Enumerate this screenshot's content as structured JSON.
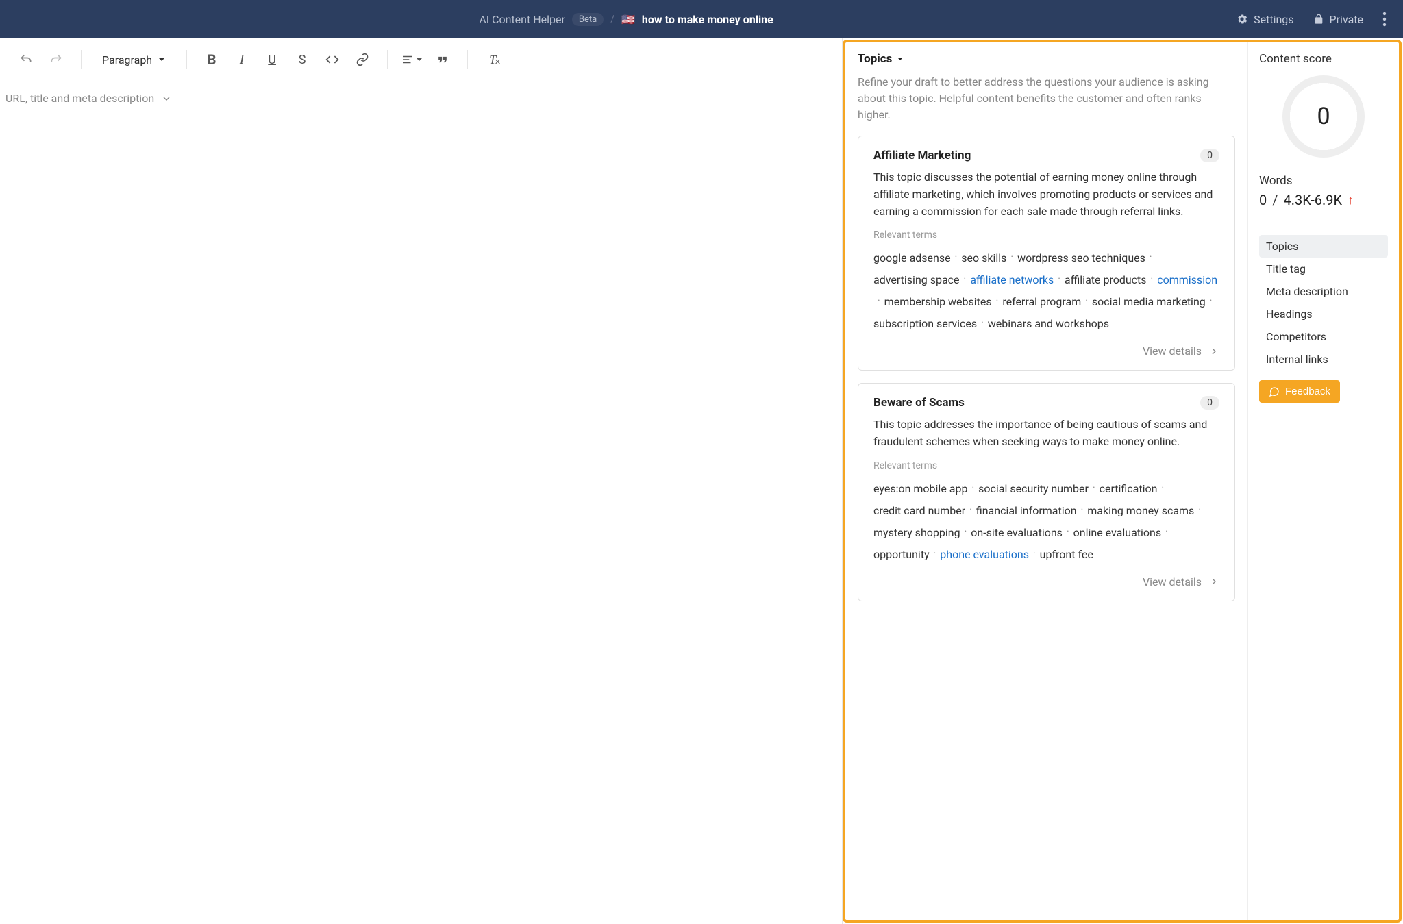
{
  "header": {
    "title": "AI Content Helper",
    "badge": "Beta",
    "separator": "/",
    "flag": "🇺🇸",
    "topic": "how to make money online",
    "settings": "Settings",
    "private": "Private"
  },
  "toolbar": {
    "paragraph": "Paragraph"
  },
  "meta": {
    "label": "URL, title and meta description"
  },
  "topics": {
    "heading": "Topics",
    "description": "Refine your draft to better address the questions your audience is asking about this topic. Helpful content benefits the customer and often ranks higher.",
    "cards": [
      {
        "title": "Affiliate Marketing",
        "count": "0",
        "description": "This topic discusses the potential of earning money online through affiliate marketing, which involves promoting products or services and earning a commission for each sale made through referral links.",
        "terms_label": "Relevant terms",
        "terms": [
          {
            "text": "google adsense"
          },
          {
            "text": "seo skills"
          },
          {
            "text": "wordpress seo techniques"
          },
          {
            "text": "advertising space"
          },
          {
            "text": "affiliate networks",
            "link": true
          },
          {
            "text": "affiliate products"
          },
          {
            "text": "commission",
            "link": true
          },
          {
            "text": "membership websites"
          },
          {
            "text": "referral program"
          },
          {
            "text": "social media marketing"
          },
          {
            "text": "subscription services"
          },
          {
            "text": "webinars and workshops"
          }
        ],
        "view": "View details"
      },
      {
        "title": "Beware of Scams",
        "count": "0",
        "description": "This topic addresses the importance of being cautious of scams and fraudulent schemes when seeking ways to make money online.",
        "terms_label": "Relevant terms",
        "terms": [
          {
            "text": "eyes:on mobile app"
          },
          {
            "text": "social security number"
          },
          {
            "text": "certification"
          },
          {
            "text": "credit card number"
          },
          {
            "text": "financial information"
          },
          {
            "text": "making money scams"
          },
          {
            "text": "mystery shopping"
          },
          {
            "text": "on-site evaluations"
          },
          {
            "text": "online evaluations"
          },
          {
            "text": "opportunity"
          },
          {
            "text": "phone evaluations",
            "link": true
          },
          {
            "text": "upfront fee"
          }
        ],
        "view": "View details"
      }
    ]
  },
  "score": {
    "title": "Content score",
    "value": "0",
    "words_label": "Words",
    "words_count": "0",
    "words_sep": "/",
    "words_range": "4.3K-6.9K",
    "nav": [
      "Topics",
      "Title tag",
      "Meta description",
      "Headings",
      "Competitors",
      "Internal links"
    ],
    "feedback": "Feedback"
  }
}
